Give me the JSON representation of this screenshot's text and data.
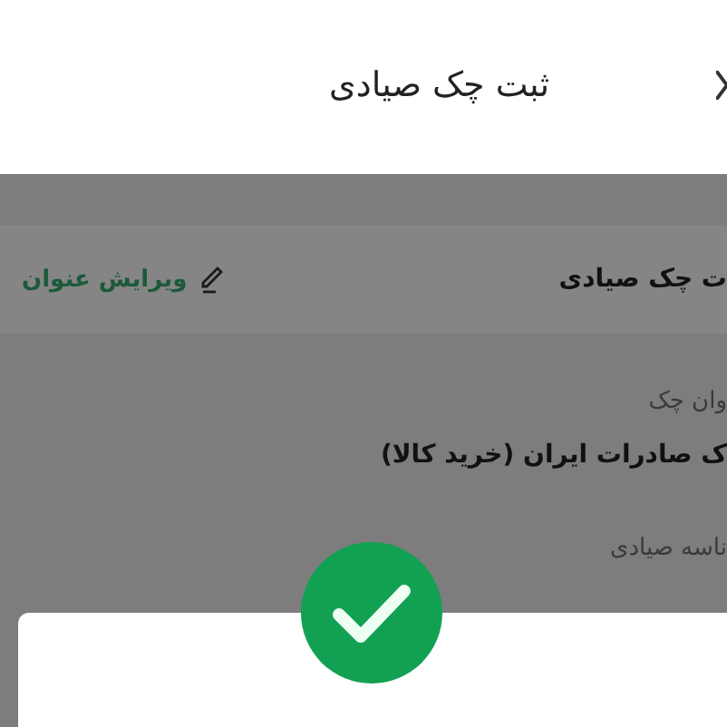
{
  "header": {
    "title": "ثبت چک صیادی"
  },
  "title_row": {
    "title": "ت چک صیادی",
    "edit_link": "ویرایش عنوان"
  },
  "fields": [
    {
      "label": "وان چک",
      "value": "ک صادرات ایران (خرید کالا)"
    },
    {
      "label": "ناسه صیادی"
    }
  ],
  "dialog": {
    "success": true
  }
}
